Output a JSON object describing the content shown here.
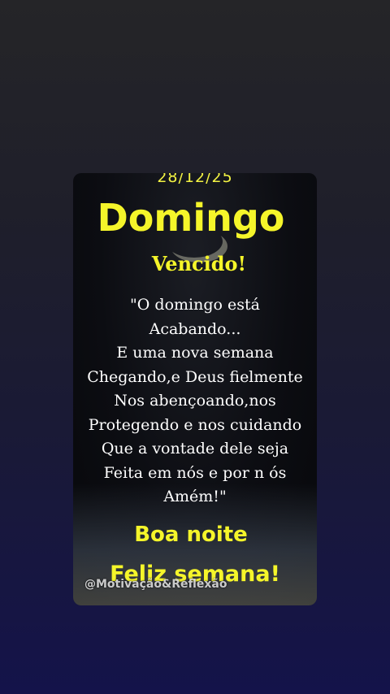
{
  "post": {
    "date": "28/12/25",
    "day": "Domingo",
    "subtitle": "Vencido!",
    "quote_lines": [
      "\"O domingo está",
      "Acabando...",
      "E uma nova semana",
      "Chegando,e Deus fielmente",
      "Nos abençoando,nos",
      "Protegendo e nos cuidando",
      "Que a vontade dele seja",
      "Feita em nós e por n ós",
      "Amém!\""
    ],
    "greeting": "Boa noite",
    "closing": "Feliz semana!",
    "watermark": "@Motivação&Reflexão"
  },
  "colors": {
    "accent_yellow": "#f5f52a",
    "text_white": "#ffffff"
  }
}
